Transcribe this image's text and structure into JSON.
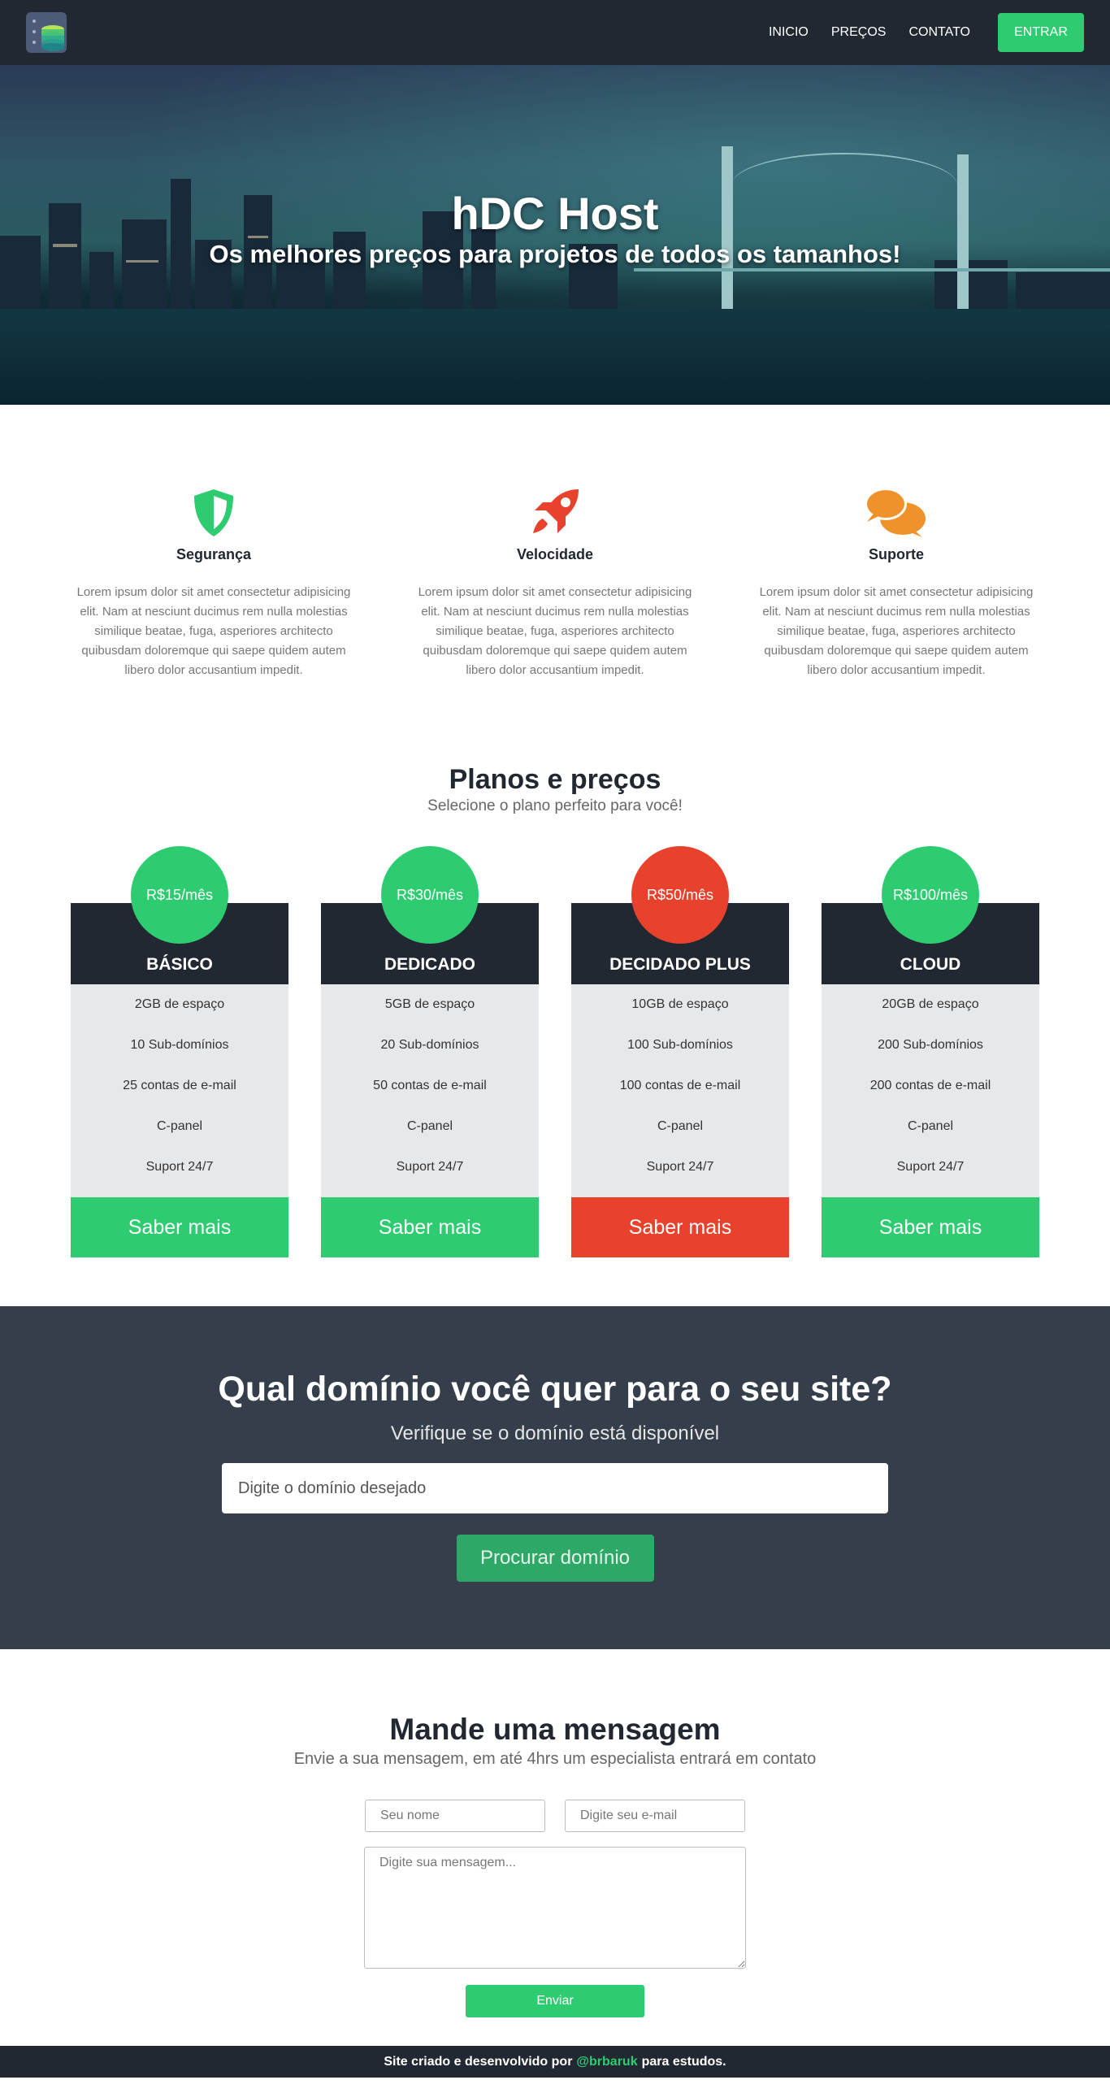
{
  "colors": {
    "dark": "#222831",
    "accent_green": "#2ecc71",
    "accent_red": "#e8412c",
    "domain_bg": "#343f4b",
    "card_body": "#e7e8ea"
  },
  "nav": {
    "logo_icon": "server-database-icon",
    "links": [
      "INICIO",
      "PREÇOS",
      "CONTATO"
    ],
    "enter_label": "ENTRAR"
  },
  "hero": {
    "title": "hDC Host",
    "subtitle": "Os melhores preços para projetos de todos os tamanhos!"
  },
  "features": [
    {
      "icon": "shield-icon",
      "title": "Segurança",
      "text": "Lorem ipsum dolor sit amet consectetur adipisicing elit. Nam at nesciunt ducimus rem nulla molestias similique beatae, fuga, asperiores architecto quibusdam doloremque qui saepe quidem autem libero dolor accusantium impedit."
    },
    {
      "icon": "rocket-icon",
      "title": "Velocidade",
      "text": "Lorem ipsum dolor sit amet consectetur adipisicing elit. Nam at nesciunt ducimus rem nulla molestias similique beatae, fuga, asperiores architecto quibusdam doloremque qui saepe quidem autem libero dolor accusantium impedit."
    },
    {
      "icon": "chat-bubbles-icon",
      "title": "Suporte",
      "text": "Lorem ipsum dolor sit amet consectetur adipisicing elit. Nam at nesciunt ducimus rem nulla molestias similique beatae, fuga, asperiores architecto quibusdam doloremque qui saepe quidem autem libero dolor accusantium impedit."
    }
  ],
  "plans": {
    "title": "Planos e preços",
    "subtitle": "Selecione o plano perfeito para você!",
    "items": [
      {
        "price": "R$15/mês",
        "name": "BÁSICO",
        "features": [
          "2GB de espaço",
          "10 Sub-domínios",
          "25 contas de e-mail",
          "C-panel",
          "Suport 24/7"
        ],
        "button": "Saber mais"
      },
      {
        "price": "R$30/mês",
        "name": "DEDICADO",
        "features": [
          "5GB de espaço",
          "20 Sub-domínios",
          "50 contas de e-mail",
          "C-panel",
          "Suport 24/7"
        ],
        "button": "Saber mais"
      },
      {
        "price": "R$50/mês",
        "name": "DECIDADO PLUS",
        "features": [
          "10GB de espaço",
          "100 Sub-domínios",
          "100 contas de e-mail",
          "C-panel",
          "Suport 24/7"
        ],
        "button": "Saber mais"
      },
      {
        "price": "R$100/mês",
        "name": "CLOUD",
        "features": [
          "20GB de espaço",
          "200 Sub-domínios",
          "200 contas de e-mail",
          "C-panel",
          "Suport 24/7"
        ],
        "button": "Saber mais"
      }
    ]
  },
  "domain": {
    "title": "Qual domínio você quer para o seu site?",
    "subtitle": "Verifique se o domínio está disponível",
    "placeholder": "Digite o domínio desejado",
    "button": "Procurar domínio"
  },
  "contact": {
    "title": "Mande uma mensagem",
    "subtitle": "Envie a sua mensagem, em até 4hrs um especialista entrará em contato",
    "name_placeholder": "Seu nome",
    "email_placeholder": "Digite seu e-mail",
    "message_placeholder": "Digite sua mensagem...",
    "button": "Enviar"
  },
  "footer": {
    "prefix": "Site criado e desenvolvido por",
    "handle": "@brbaruk",
    "suffix": "para estudos."
  }
}
